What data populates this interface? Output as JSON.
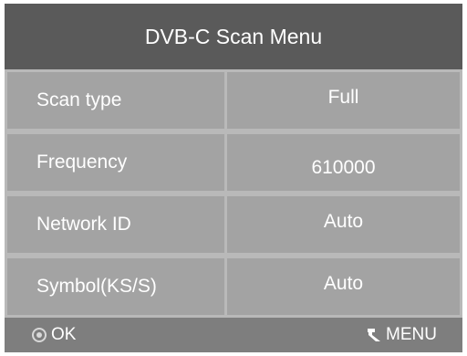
{
  "header": {
    "title": "DVB-C Scan Menu"
  },
  "rows": [
    {
      "label": "Scan type",
      "value": "Full"
    },
    {
      "label": "Frequency",
      "value": "610000"
    },
    {
      "label": "Network ID",
      "value": "Auto"
    },
    {
      "label": "Symbol(KS/S)",
      "value": "Auto"
    }
  ],
  "footer": {
    "ok_label": "OK",
    "ok_icon": "ok-circle-icon",
    "menu_label": "MENU",
    "menu_icon": "return-arrow-icon"
  },
  "colors": {
    "header_bg": "#5a5a5a",
    "cell_bg": "#a3a3a3",
    "grid_lines": "#b9b9b9",
    "footer_bg": "#7e7e7e",
    "text": "#ffffff"
  }
}
